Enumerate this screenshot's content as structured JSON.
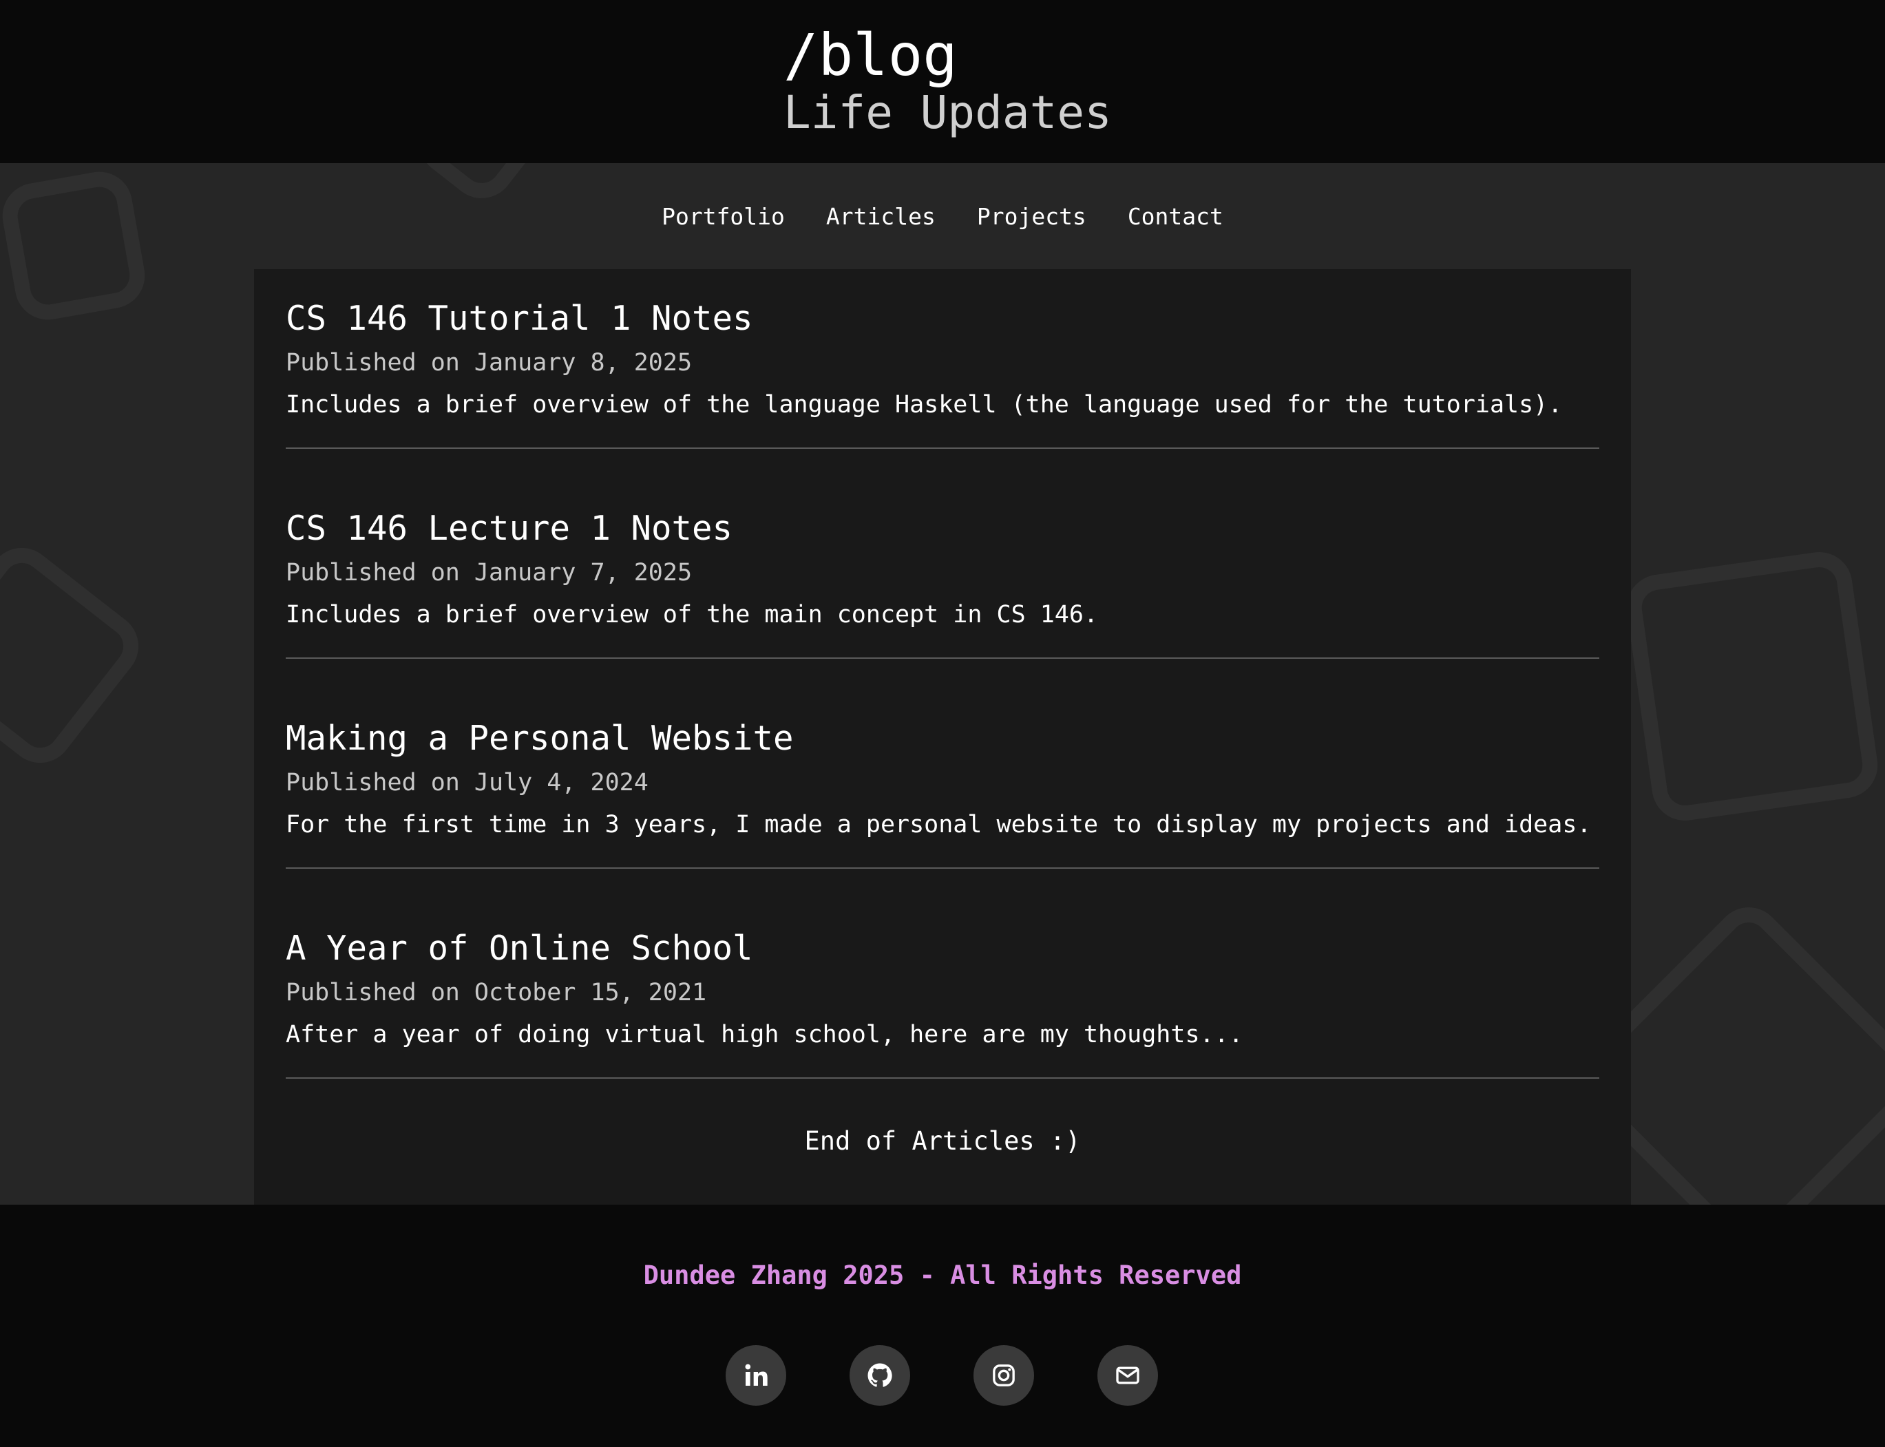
{
  "header": {
    "title": "/blog",
    "subtitle": "Life Updates"
  },
  "nav": {
    "items": [
      {
        "label": "Portfolio"
      },
      {
        "label": "Articles"
      },
      {
        "label": "Projects"
      },
      {
        "label": "Contact"
      }
    ]
  },
  "posts": [
    {
      "title": "CS 146 Tutorial 1 Notes",
      "date": "Published on January 8, 2025",
      "description": "Includes a brief overview of the language Haskell (the language used for the tutorials)."
    },
    {
      "title": "CS 146 Lecture 1 Notes",
      "date": "Published on January 7, 2025",
      "description": "Includes a brief overview of the main concept in CS 146."
    },
    {
      "title": "Making a Personal Website",
      "date": "Published on July 4, 2024",
      "description": "For the first time in 3 years, I made a personal website to display my projects and ideas."
    },
    {
      "title": "A Year of Online School",
      "date": "Published on October 15, 2021",
      "description": "After a year of doing virtual high school, here are my thoughts..."
    }
  ],
  "end_text": "End of Articles :)",
  "footer": {
    "copyright": "Dundee Zhang 2025 - All Rights Reserved",
    "socials": [
      {
        "icon": "linkedin-icon"
      },
      {
        "icon": "github-icon"
      },
      {
        "icon": "instagram-icon"
      },
      {
        "icon": "email-icon"
      }
    ]
  },
  "colors": {
    "accent": "#d98ee3",
    "header_bg": "#090909",
    "page_bg": "#262626",
    "content_bg": "#191919"
  }
}
